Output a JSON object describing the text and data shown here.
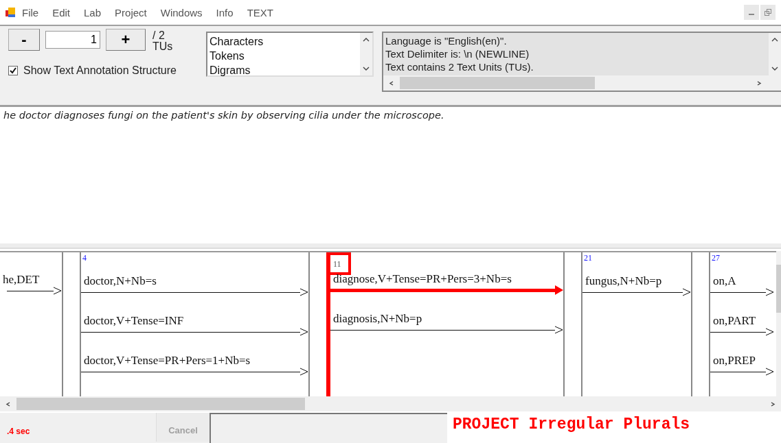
{
  "menu": [
    "File",
    "Edit",
    "Lab",
    "Project",
    "Windows",
    "Info",
    "TEXT"
  ],
  "toolbar": {
    "minus": "-",
    "tu_value": "1",
    "plus": "+",
    "tu_total": "/ 2",
    "tu_unit": "TUs",
    "show_structure": {
      "label": "Show Text Annotation Structure",
      "checked": true
    }
  },
  "views": [
    {
      "label": "Characters",
      "selected": false
    },
    {
      "label": "Tokens",
      "selected": false
    },
    {
      "label": "Digrams",
      "selected": false
    }
  ],
  "info_lines": [
    "Language is \"English(en)\".",
    "Text Delimiter is: \\n (NEWLINE)",
    "Text contains 2 Text Units (TUs)."
  ],
  "sentence": "he doctor diagnoses fungi on the patient's skin by observing cilia under the microscope.",
  "tokens": [
    {
      "selected": false,
      "annotations": [
        {
          "label": "he,DET",
          "selected": false
        }
      ]
    },
    {
      "number": "4",
      "selected": false,
      "annotations": [
        {
          "label": "doctor,N+Nb=s",
          "selected": false
        },
        {
          "label": "doctor,V+Tense=INF",
          "selected": false
        },
        {
          "label": "doctor,V+Tense=PR+Pers=1+Nb=s",
          "selected": false
        }
      ]
    },
    {
      "number": "11",
      "selected": true,
      "annotations": [
        {
          "label": "diagnose,V+Tense=PR+Pers=3+Nb=s",
          "selected": true
        },
        {
          "label": "diagnosis,N+Nb=p",
          "selected": false
        }
      ]
    },
    {
      "number": "21",
      "selected": false,
      "annotations": [
        {
          "label": "fungus,N+Nb=p",
          "selected": false
        }
      ]
    },
    {
      "number": "27",
      "selected": false,
      "annotations": [
        {
          "label": "on,A",
          "selected": false
        },
        {
          "label": "on,PART",
          "selected": false
        },
        {
          "label": "on,PREP",
          "selected": false
        }
      ]
    }
  ],
  "status": {
    "time": ".4 sec",
    "cancel": {
      "label": "Cancel",
      "disabled": true
    },
    "project": "PROJECT Irregular Plurals"
  }
}
